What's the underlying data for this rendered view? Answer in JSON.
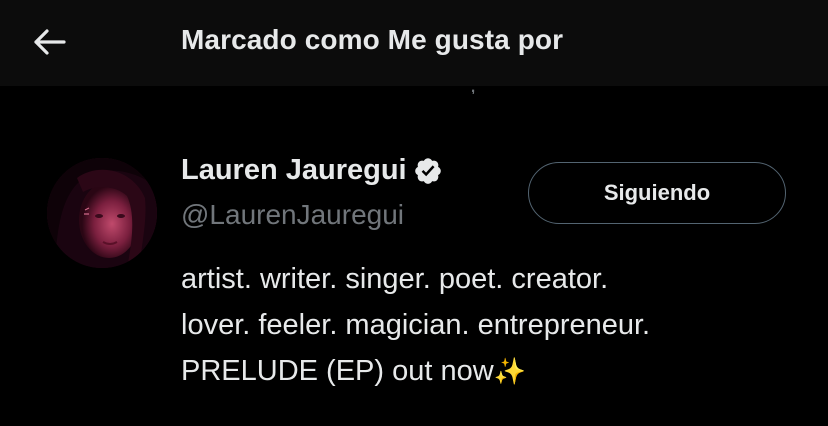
{
  "header": {
    "back_icon": "arrow-left-icon",
    "title": "Marcado como Me gusta por",
    "clipped_fragment": ","
  },
  "user": {
    "avatar_icon": "avatar",
    "name": "Lauren Jauregui",
    "verified_icon": "verified-badge-icon",
    "handle": "@LaurenJauregui",
    "follow_button_label": "Siguiendo",
    "bio_lines": [
      "artist. writer. singer. poet. creator.",
      "lover. feeler. magician. entrepreneur.",
      "PRELUDE (EP) out now"
    ],
    "bio_emoji": "✨"
  },
  "colors": {
    "background": "#000000",
    "header_background": "#0c0c0c",
    "primary_text": "#e7e9ea",
    "secondary_text": "#71767b",
    "button_border": "#536471"
  }
}
